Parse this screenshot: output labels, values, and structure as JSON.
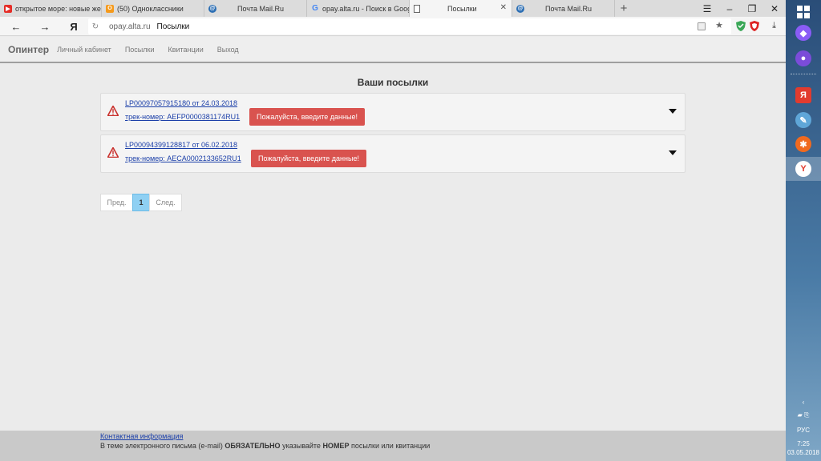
{
  "browser": {
    "tabs": [
      {
        "title": "открытое море: новые жерт",
        "icon": "youtube-icon"
      },
      {
        "title": "(50) Одноклассники",
        "icon": "odnoklassniki-icon"
      },
      {
        "title": "Почта Mail.Ru",
        "icon": "mail-ru-icon"
      },
      {
        "title": "opay.alta.ru - Поиск в Goog",
        "icon": "google-icon"
      },
      {
        "title": "Посылки",
        "icon": "page-icon",
        "active": true
      },
      {
        "title": "Почта Mail.Ru",
        "icon": "mail-ru-icon"
      }
    ],
    "new_tab": "+",
    "address": {
      "domain": "opay.alta.ru",
      "title": "Посылки"
    },
    "yandex_glyph": "Я"
  },
  "site": {
    "brand": "Опинтер",
    "nav": [
      "Личный кабинет",
      "Посылки",
      "Квитанции",
      "Выход"
    ],
    "heading": "Ваши посылки",
    "parcels": [
      {
        "order": "LP00097057915180 от 24.03.2018",
        "track": "трек-номер: AEFP0000381174RU1",
        "alert": "Пожалуйста, введите данные!"
      },
      {
        "order": "LP00094399128817 от 06.02.2018",
        "track": "трек-номер: AECA0002133652RU1",
        "alert": "Пожалуйста, введите данные!"
      }
    ],
    "pagination": {
      "prev": "Пред.",
      "current": "1",
      "next": "След."
    },
    "footer": {
      "contact": "Контактная информация",
      "note_pre": "В теме электронного письма (e-mail) ",
      "note_b1": "ОБЯЗАТЕЛЬНО",
      "note_mid": " указывайте ",
      "note_b2": "НОМЕР",
      "note_post": " посылки или квитанции"
    }
  },
  "taskbar": {
    "language": "РУС",
    "time": "7:25",
    "date": "03.05.2018"
  },
  "colors": {
    "alert_red": "#d9534f",
    "link_blue": "#1a3ea8",
    "page_active": "#8fd0f3"
  }
}
